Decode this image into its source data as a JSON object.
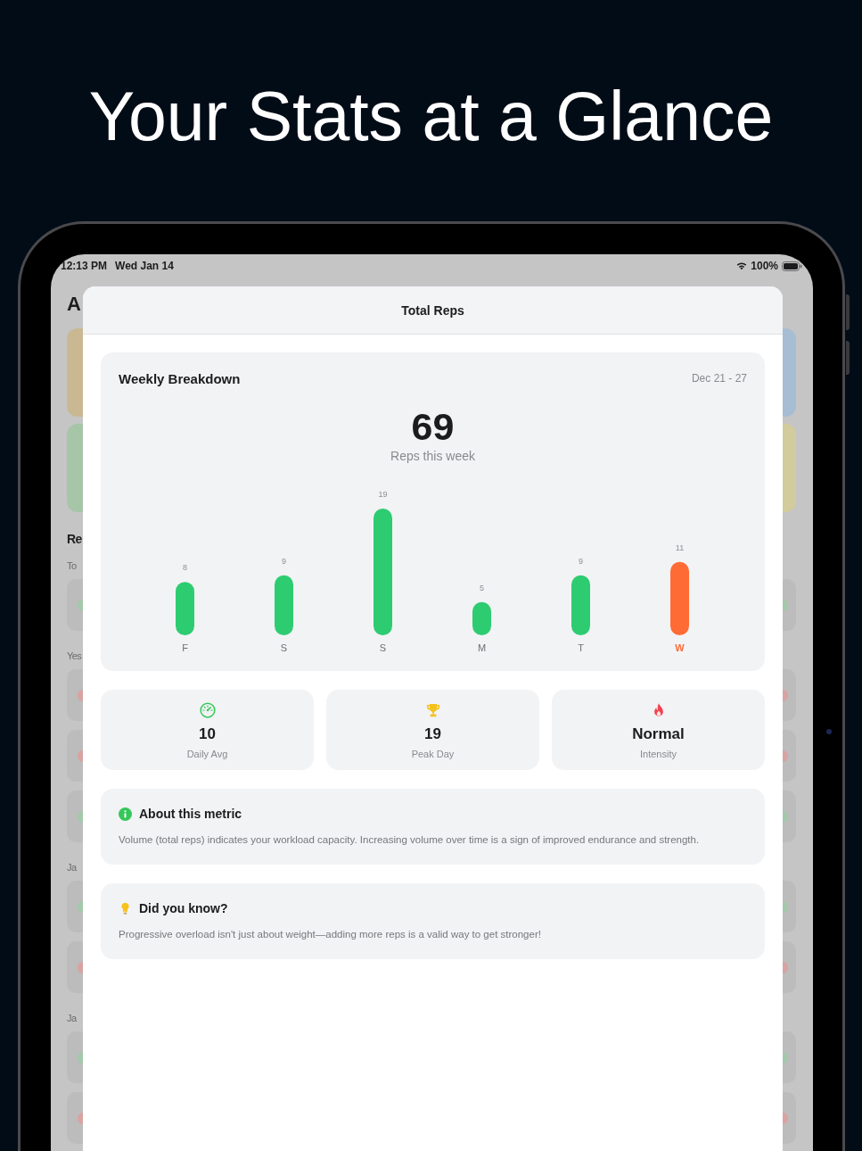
{
  "headline": "Your Stats at a Glance",
  "status_bar": {
    "time": "12:13 PM",
    "date": "Wed Jan 14",
    "battery": "100%"
  },
  "background_app": {
    "rows": [
      {
        "kind": "title",
        "text": "A"
      },
      {
        "kind": "cards",
        "left": {
          "color": "#cab893"
        },
        "right": {
          "color": "#a6bdd3"
        }
      },
      {
        "kind": "cards",
        "left": {
          "color": "#a7c5a7"
        },
        "right": {
          "color": "#d2cb9b"
        }
      },
      {
        "kind": "heading",
        "text": "Re"
      },
      {
        "kind": "label",
        "text": "To"
      },
      {
        "kind": "entry",
        "left": {
          "color": "#a3c9aa"
        },
        "right": {
          "color": "#a3c9aa"
        }
      },
      {
        "kind": "label",
        "text": "Yes"
      },
      {
        "kind": "entry",
        "left": {
          "color": "#d8a3a1"
        },
        "right": {
          "color": "#d8a3a1"
        }
      },
      {
        "kind": "entry",
        "left": {
          "color": "#d8a3a1"
        },
        "right": {
          "color": "#d8a3a1"
        }
      },
      {
        "kind": "entry",
        "left": {
          "color": "#a3c9aa"
        },
        "right": {
          "color": "#a3c9aa"
        }
      },
      {
        "kind": "label",
        "text": "Ja"
      },
      {
        "kind": "entry",
        "left": {
          "color": "#a3c9aa"
        },
        "right": {
          "color": "#a3c9aa"
        }
      },
      {
        "kind": "entry",
        "left": {
          "color": "#d8a3a1"
        },
        "right": {
          "color": "#d8a3a1"
        }
      },
      {
        "kind": "label",
        "text": "Ja"
      },
      {
        "kind": "entry",
        "left": {
          "color": "#a3c9aa"
        },
        "right": {
          "color": "#a3c9aa"
        }
      },
      {
        "kind": "entry",
        "left": {
          "color": "#d8a3a1"
        },
        "right": {
          "color": "#d8a3a1"
        }
      }
    ]
  },
  "sheet": {
    "title": "Total Reps",
    "weekly": {
      "title": "Weekly Breakdown",
      "range": "Dec 21 - 27",
      "total": "69",
      "total_label": "Reps this week",
      "chart_data": {
        "type": "bar",
        "categories": [
          "F",
          "S",
          "S",
          "M",
          "T",
          "W"
        ],
        "series": [
          {
            "color": "#2ecc71",
            "values": [
              8,
              9,
              19,
              5,
              9,
              null
            ]
          },
          {
            "color": "#ff6b35",
            "values": [
              null,
              null,
              null,
              null,
              null,
              11
            ]
          }
        ],
        "stacked": true,
        "data_labels": true
      }
    },
    "stats": [
      {
        "kind": "gauge",
        "value": "10",
        "label": "Daily Avg"
      },
      {
        "kind": "trophy",
        "value": "19",
        "label": "Peak Day"
      },
      {
        "kind": "flame",
        "value": "Normal",
        "label": "Intensity"
      }
    ],
    "notes": [
      {
        "kind": "info",
        "title": "About this metric",
        "text": "Volume (total reps) indicates your workload capacity. Increasing volume over time is a sign of improved endurance and strength."
      },
      {
        "kind": "tip",
        "title": "Did you know?",
        "text": "Progressive overload isn't just about weight—adding more reps is a valid way to get stronger!"
      }
    ]
  }
}
